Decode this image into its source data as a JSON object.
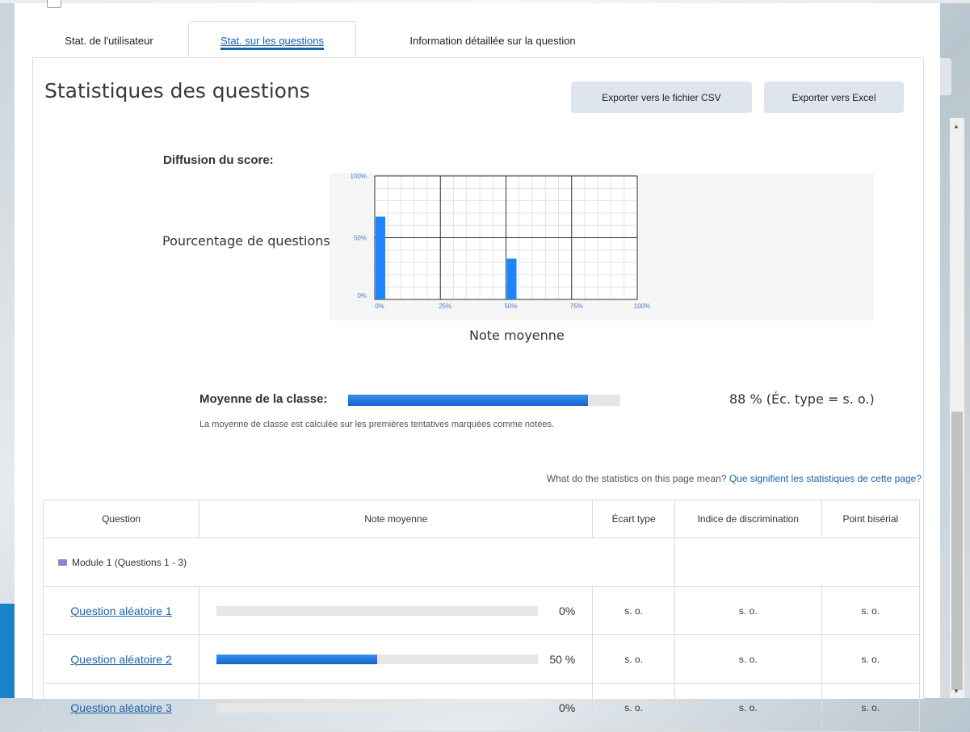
{
  "tabs": [
    {
      "label": "Stat. de l'utilisateur",
      "active": false
    },
    {
      "label": "Stat. sur les questions",
      "active": true
    },
    {
      "label": "Information détaillée sur la question",
      "active": false
    }
  ],
  "page_title": "Statistiques des questions",
  "buttons": {
    "export_csv": "Exporter vers le fichier CSV",
    "export_excel": "Exporter vers Excel"
  },
  "score_distribution": {
    "label": "Diffusion du score:",
    "y_label": "Pourcentage de questions",
    "x_label": "Note moyenne"
  },
  "chart_data": {
    "type": "bar",
    "categories": [
      "0%",
      "25%",
      "50%",
      "75%",
      "100%"
    ],
    "x": [
      0,
      50
    ],
    "values": [
      67,
      33
    ],
    "xlabel": "Note moyenne",
    "ylabel": "Pourcentage de questions",
    "xlim": [
      0,
      100
    ],
    "ylim": [
      0,
      100
    ],
    "y_ticks": [
      "0%",
      "50%",
      "100%"
    ],
    "x_ticks": [
      "0%",
      "25%",
      "50%",
      "75%",
      "100%"
    ],
    "grid": true,
    "colors": {
      "bar": "#1b84ff"
    }
  },
  "class_average": {
    "label": "Moyenne de la classe:",
    "value_fraction": 0.88,
    "value_text": "88 % (Éc. type = s. o.)",
    "note": "La moyenne de classe est calculée sur les premières tentatives marquées comme notées."
  },
  "help": {
    "text": "What do the statistics on this page mean?",
    "link": "Que signifient les statistiques de cette page?"
  },
  "table": {
    "headers": [
      "Question",
      "Note moyenne",
      "Écart type",
      "Indice de discrimination",
      "Point bisérial"
    ],
    "module": "Module 1 (Questions 1 - 3)",
    "rows": [
      {
        "question": "Question aléatoire 1",
        "fraction": 0,
        "pct": "0%",
        "std": "s. o.",
        "disc": "s. o.",
        "pb": "s. o."
      },
      {
        "question": "Question aléatoire 2",
        "fraction": 0.5,
        "pct": "50 %",
        "std": "s. o.",
        "disc": "s. o.",
        "pb": "s. o."
      },
      {
        "question": "Question aléatoire 3",
        "fraction": 0,
        "pct": "0%",
        "std": "s. o.",
        "disc": "s. o.",
        "pb": "s. o."
      }
    ]
  }
}
